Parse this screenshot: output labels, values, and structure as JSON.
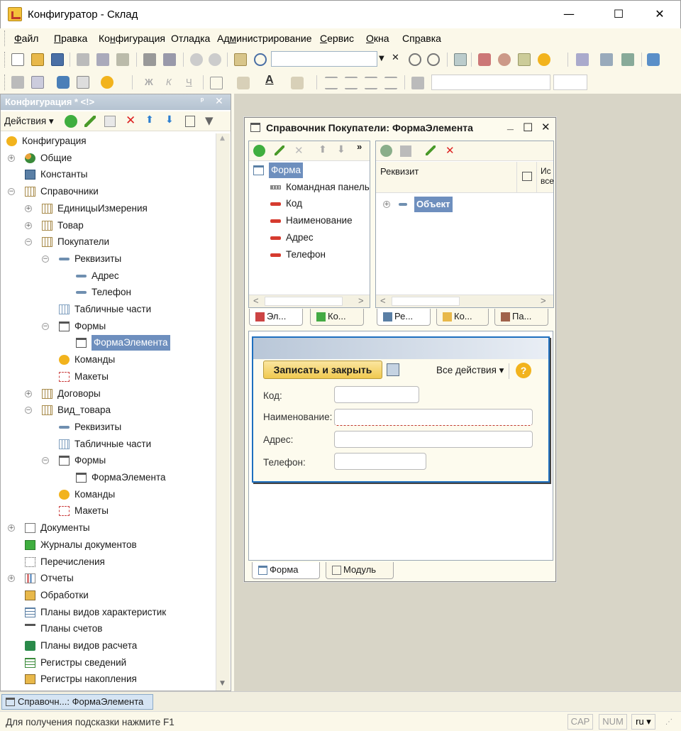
{
  "window": {
    "title": "Конфигуратор - Склад",
    "minimize": "—",
    "maximize": "☐",
    "close": "✕"
  },
  "menu": [
    {
      "pre": "",
      "u": "Ф",
      "post": "айл"
    },
    {
      "pre": "",
      "u": "П",
      "post": "равка"
    },
    {
      "pre": "Ко",
      "u": "н",
      "post": "фигурация"
    },
    {
      "pre": "Отла",
      "u": "д",
      "post": "ка"
    },
    {
      "pre": "Ад",
      "u": "м",
      "post": "инистрирование"
    },
    {
      "pre": "",
      "u": "С",
      "post": "ервис"
    },
    {
      "pre": "",
      "u": "О",
      "post": "кна"
    },
    {
      "pre": "Сп",
      "u": "р",
      "post": "авка"
    }
  ],
  "config_panel": {
    "title": "Конфигурация * <!>",
    "pin": "ᵖ",
    "close": "✕",
    "actions_label": "Действия",
    "tree": [
      {
        "label": "Конфигурация",
        "icon": "configuration-icon",
        "exp": ""
      },
      {
        "label": "Общие",
        "icon": "common-icon",
        "exp": "+"
      },
      {
        "label": "Константы",
        "icon": "constants-icon",
        "exp": ""
      },
      {
        "label": "Справочники",
        "icon": "catalog-icon",
        "exp": "−"
      },
      {
        "label": "ЕдиницыИзмерения",
        "icon": "catalog-icon",
        "exp": "+"
      },
      {
        "label": "Товар",
        "icon": "catalog-icon",
        "exp": "+"
      },
      {
        "label": "Покупатели",
        "icon": "catalog-icon",
        "exp": "−"
      },
      {
        "label": "Реквизиты",
        "icon": "attribute-icon",
        "exp": "−"
      },
      {
        "label": "Адрес",
        "icon": "attribute-icon",
        "exp": ""
      },
      {
        "label": "Телефон",
        "icon": "attribute-icon",
        "exp": ""
      },
      {
        "label": "Табличные части",
        "icon": "tabular-icon",
        "exp": ""
      },
      {
        "label": "Формы",
        "icon": "form-icon",
        "exp": "−"
      },
      {
        "label": "ФормаЭлемента",
        "icon": "form-icon",
        "exp": "",
        "selected": true
      },
      {
        "label": "Команды",
        "icon": "command-icon",
        "exp": ""
      },
      {
        "label": "Макеты",
        "icon": "template-icon",
        "exp": ""
      },
      {
        "label": "Договоры",
        "icon": "catalog-icon",
        "exp": "+"
      },
      {
        "label": "Вид_товара",
        "icon": "catalog-icon",
        "exp": "−"
      },
      {
        "label": "Реквизиты",
        "icon": "attribute-icon",
        "exp": ""
      },
      {
        "label": "Табличные части",
        "icon": "tabular-icon",
        "exp": ""
      },
      {
        "label": "Формы",
        "icon": "form-icon",
        "exp": "−"
      },
      {
        "label": "ФормаЭлемента",
        "icon": "form-icon",
        "exp": ""
      },
      {
        "label": "Команды",
        "icon": "command-icon",
        "exp": ""
      },
      {
        "label": "Макеты",
        "icon": "template-icon",
        "exp": ""
      },
      {
        "label": "Документы",
        "icon": "document-icon",
        "exp": "+"
      },
      {
        "label": "Журналы документов",
        "icon": "journal-icon",
        "exp": ""
      },
      {
        "label": "Перечисления",
        "icon": "enum-icon",
        "exp": ""
      },
      {
        "label": "Отчеты",
        "icon": "report-icon",
        "exp": "+"
      },
      {
        "label": "Обработки",
        "icon": "dataprocessor-icon",
        "exp": ""
      },
      {
        "label": "Планы видов характеристик",
        "icon": "chart-of-characteristic-types-icon",
        "exp": ""
      },
      {
        "label": "Планы счетов",
        "icon": "chart-of-accounts-icon",
        "exp": ""
      },
      {
        "label": "Планы видов расчета",
        "icon": "chart-of-calculation-types-icon",
        "exp": ""
      },
      {
        "label": "Регистры сведений",
        "icon": "information-register-icon",
        "exp": ""
      },
      {
        "label": "Регистры накопления",
        "icon": "accumulation-register-icon",
        "exp": ""
      }
    ]
  },
  "form_window": {
    "title": "Справочник Покупатели: ФормаЭлемента",
    "min": "_",
    "max": "☐",
    "close": "✕",
    "more": "»",
    "elements": [
      {
        "label": "Форма",
        "selected": true,
        "icon": "form-icon"
      },
      {
        "label": "Командная панель",
        "icon": "command-bar-icon"
      },
      {
        "label": "Код",
        "icon": "field-icon"
      },
      {
        "label": "Наименование",
        "icon": "field-icon"
      },
      {
        "label": "Адрес",
        "icon": "field-icon"
      },
      {
        "label": "Телефон",
        "icon": "field-icon"
      }
    ],
    "left_tabs": [
      "Эл...",
      "Ко..."
    ],
    "attr_header": "Реквизит",
    "attr_header2_line1": "Ис",
    "attr_header2_line2": "все",
    "attr_row": "Объект",
    "right_tabs": [
      "Ре...",
      "Ко...",
      "Па..."
    ],
    "preview": {
      "save_close": "Записать и закрыть",
      "all_actions": "Все действия ▾",
      "help": "?",
      "fields": [
        {
          "label": "Код:"
        },
        {
          "label": "Наименование:"
        },
        {
          "label": "Адрес:"
        },
        {
          "label": "Телефон:"
        }
      ]
    },
    "bottom_tabs": [
      "Форма",
      "Модуль"
    ]
  },
  "taskbar": {
    "item": "Справочн...: ФормаЭлемента"
  },
  "status": {
    "hint": "Для получения подсказки нажмите F1",
    "cap": "CAP",
    "num": "NUM",
    "lang": "ru ▾"
  },
  "colors": {
    "selection": "#6e8fbe",
    "accent": "#1e6fbf",
    "save_button": "#f0c94f"
  }
}
